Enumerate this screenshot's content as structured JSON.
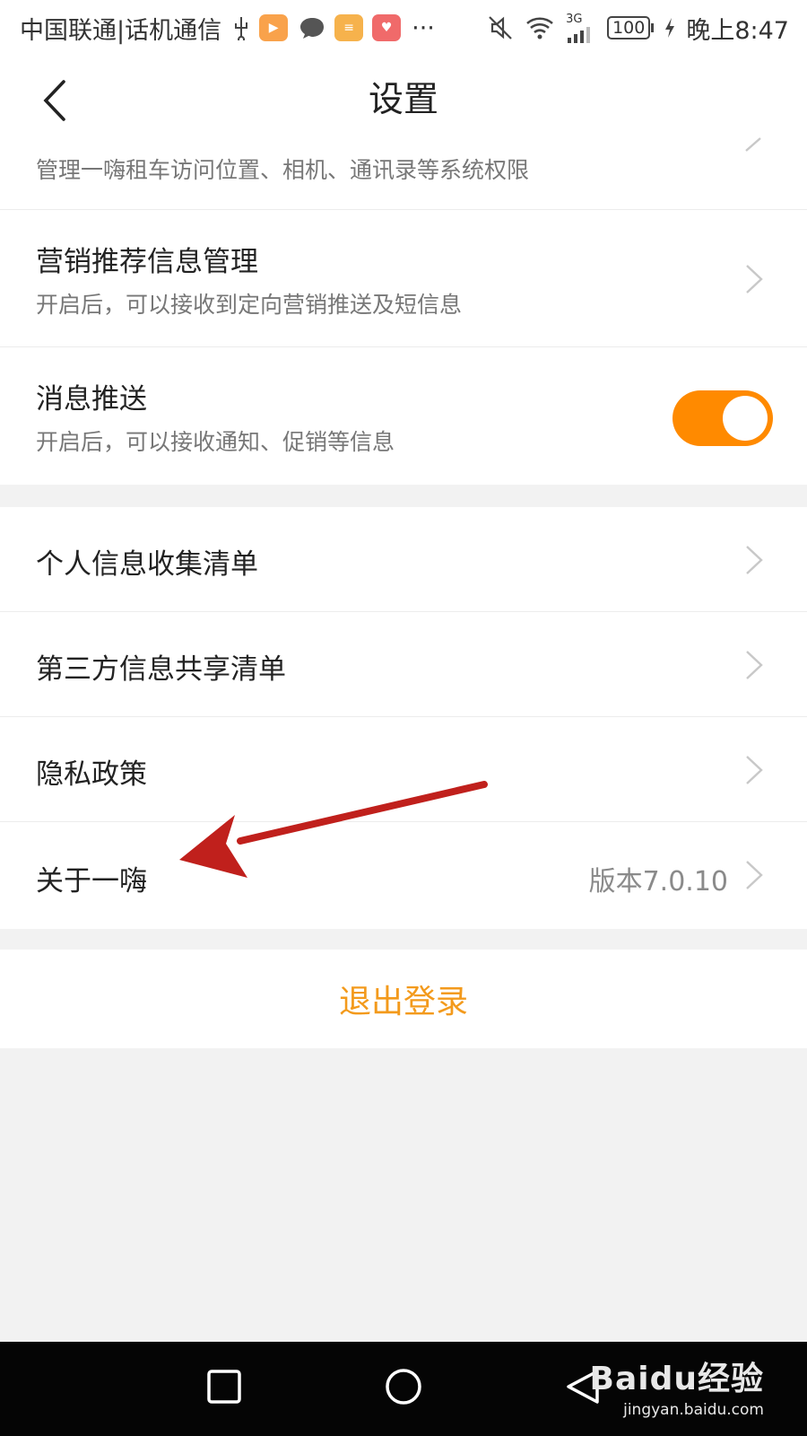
{
  "status_bar": {
    "carrier": "中国联通|话机通信",
    "network_label": "3G",
    "battery": "100",
    "time": "晚上8:47",
    "more": "···"
  },
  "header": {
    "title": "设置"
  },
  "settings_group_1": {
    "permission_subtitle": "管理一嗨租车访问位置、相机、通讯录等系统权限",
    "marketing": {
      "title": "营销推荐信息管理",
      "subtitle": "开启后，可以接收到定向营销推送及短信息"
    },
    "push": {
      "title": "消息推送",
      "subtitle": "开启后，可以接收通知、促销等信息",
      "enabled": true
    }
  },
  "settings_group_2": {
    "items": [
      {
        "label": "个人信息收集清单"
      },
      {
        "label": "第三方信息共享清单"
      },
      {
        "label": "隐私政策"
      },
      {
        "label": "关于一嗨",
        "value": "版本7.0.10"
      }
    ]
  },
  "logout": {
    "label": "退出登录"
  },
  "watermark": {
    "brand": "Baidu经验",
    "url": "jingyan.baidu.com"
  },
  "colors": {
    "accent": "#ff8a00",
    "logout_text": "#f39a1c",
    "annotation_arrow": "#c0201c"
  }
}
